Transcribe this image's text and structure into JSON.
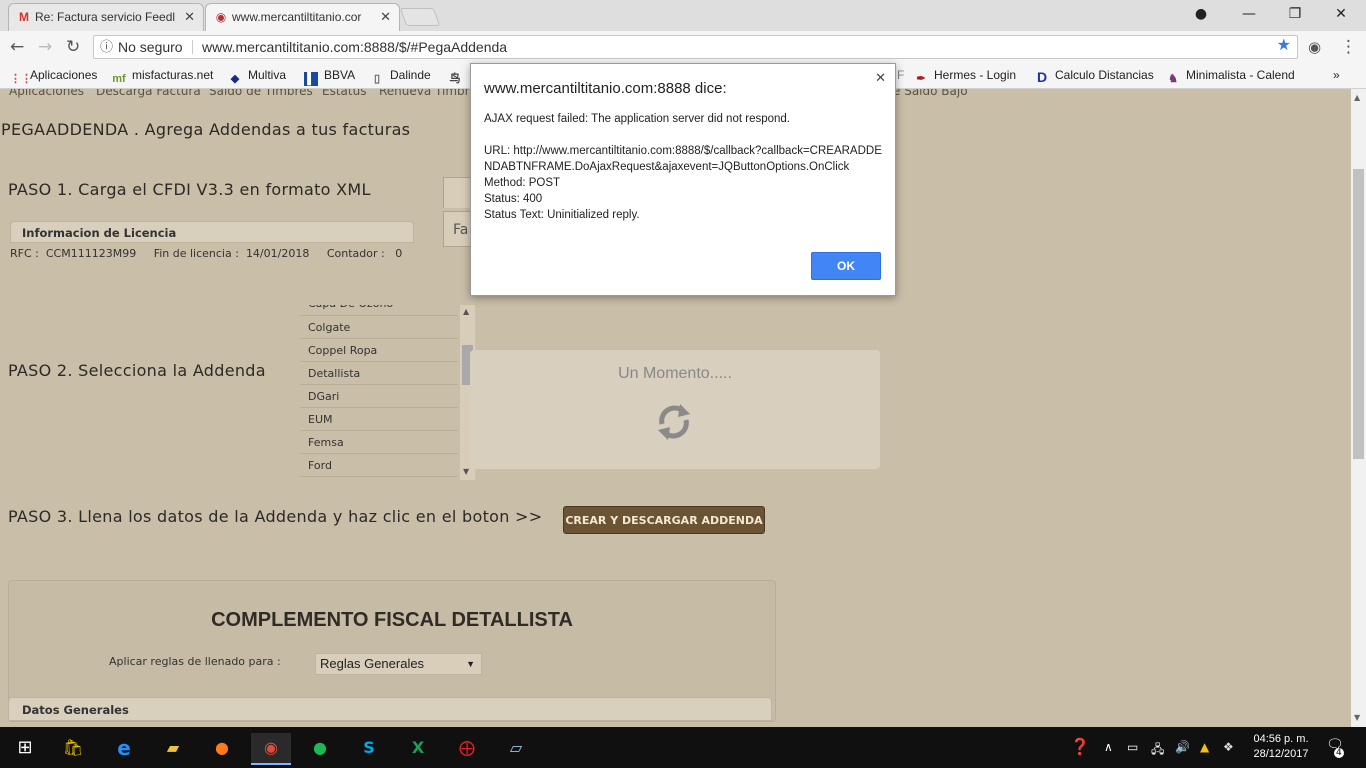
{
  "browser": {
    "tabs": [
      {
        "title": "Re: Factura servicio Feedl",
        "favicon": "gmail-icon"
      },
      {
        "title": "www.mercantiltitanio.cor",
        "favicon": "site-icon"
      }
    ],
    "omnibox": {
      "security_label": "No seguro",
      "url": "www.mercantiltitanio.com:8888/$/#PegaAddenda"
    },
    "bookmarks": [
      "Aplicaciones",
      "misfacturas.net",
      "Multiva",
      "BBVA",
      "Dalinde",
      "F",
      "Hermes - Login",
      "Calculo Distancias",
      "Minimalista - Calend"
    ]
  },
  "site": {
    "menu": [
      "Aplicaciones",
      "Descarga Factura",
      "Saldo de Timbres",
      "Estatus",
      "Renueva Timbre",
      "e Saldo Bajo"
    ],
    "title": "PEGAADDENDA . Agrega Addendas a tus facturas",
    "paso1": "PASO 1. Carga el CFDI V3.3 en formato XML",
    "side_button_text": "Fa",
    "license": {
      "header": "Informacion de Licencia",
      "rfc_label": "RFC :",
      "rfc_value": "CCM111123M99",
      "fin_label": "Fin de licencia :",
      "fin_value": "14/01/2018",
      "contador_label": "Contador :",
      "contador_value": "0"
    },
    "paso2": "PASO 2. Selecciona la Addenda",
    "addendas": [
      "Capa De Ozono",
      "Colgate",
      "Coppel Ropa",
      "Detallista",
      "DGari",
      "EUM",
      "Femsa",
      "Ford"
    ],
    "loader_text": "Un Momento.....",
    "paso3": "PASO 3. Llena los datos de la Addenda y haz clic en el boton >>",
    "crear_button": "CREAR Y DESCARGAR ADDENDA",
    "complemento_title": "COMPLEMENTO FISCAL DETALLISTA",
    "reglas_label": "Aplicar reglas de llenado para :",
    "reglas_value": "Reglas Generales",
    "datos_generales": "Datos Generales"
  },
  "dialog": {
    "title": "www.mercantiltitanio.com:8888 dice:",
    "line1": "AJAX request failed: The application server did not respond.",
    "line_url": "URL: http://www.mercantiltitanio.com:8888/$/callback?callback=CREARADDENDABTNFRAME.DoAjaxRequest&ajaxevent=JQButtonOptions.OnClick",
    "line_method": "Method: POST",
    "line_status": "Status: 400",
    "line_status_text": "Status Text: Uninitialized reply.",
    "ok_label": "OK"
  },
  "taskbar": {
    "time": "04:56 p. m.",
    "date": "28/12/2017",
    "notification_count": "4"
  }
}
